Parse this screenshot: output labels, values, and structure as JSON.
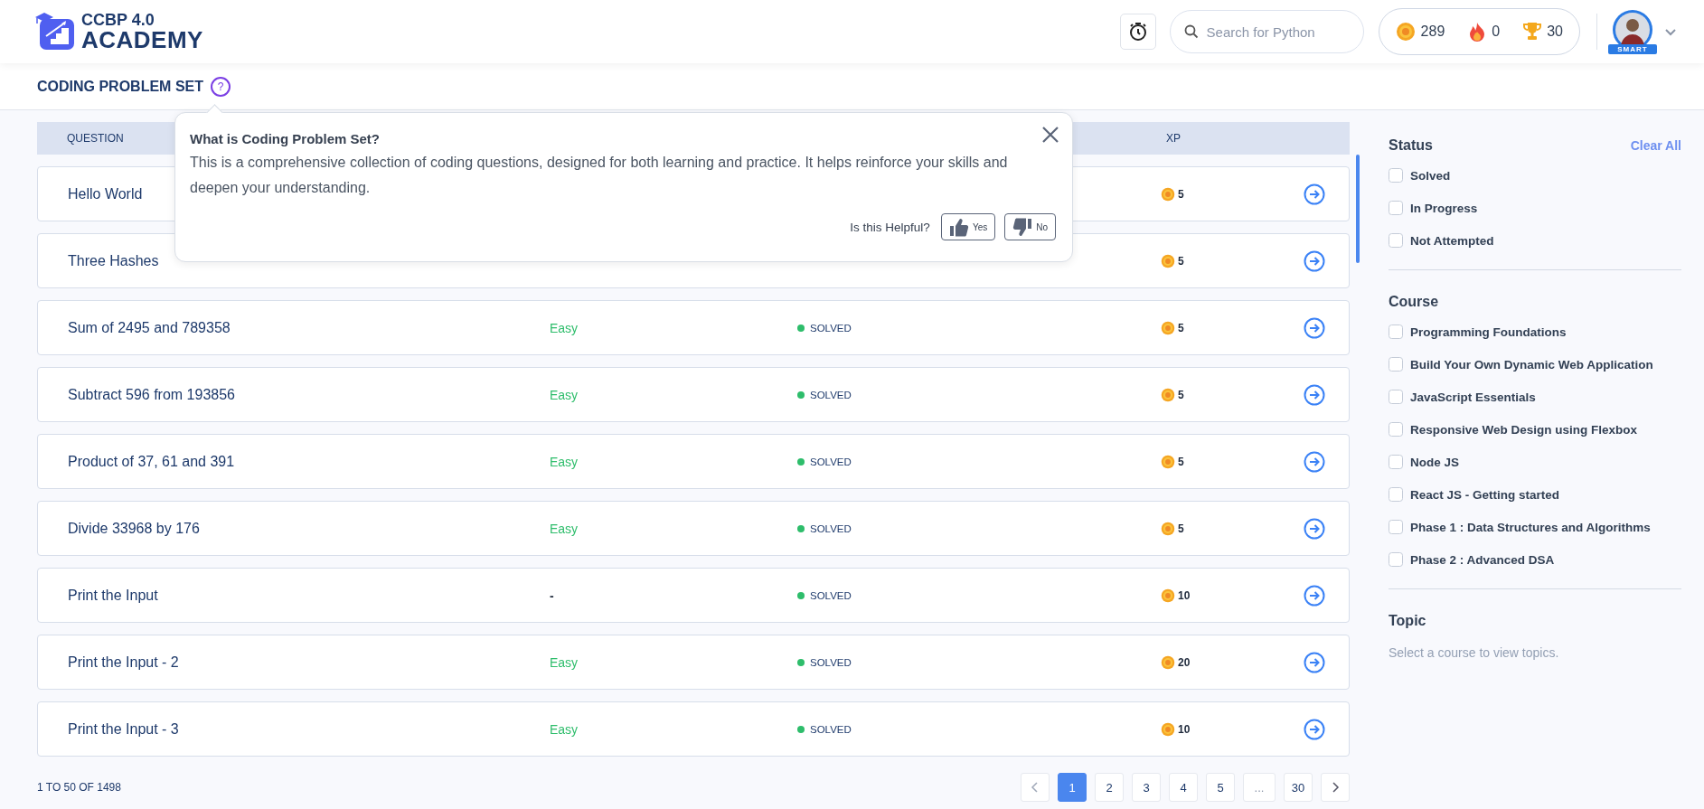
{
  "header": {
    "logo_line1": "CCBP 4.0",
    "logo_line2": "ACADEMY",
    "search": {
      "placeholder": "Search for Python"
    },
    "stats": [
      {
        "kind": "xp",
        "value": "289"
      },
      {
        "kind": "streak",
        "value": "0"
      },
      {
        "kind": "trophy",
        "value": "30"
      }
    ],
    "avatar_badge": "SMART"
  },
  "page_title": {
    "text": "CODING PROBLEM SET",
    "help_glyph": "?"
  },
  "table": {
    "columns": [
      "QUESTION",
      "XP"
    ],
    "rows": [
      {
        "question": "Hello World",
        "xp": "5"
      },
      {
        "question": "Three Hashes",
        "xp": "5"
      },
      {
        "question": "Sum of 2495 and 789358",
        "difficulty": "Easy",
        "kind": "rated",
        "status": "SOLVED",
        "xp": "5"
      },
      {
        "question": "Subtract 596 from 193856",
        "difficulty": "Easy",
        "kind": "rated",
        "status": "SOLVED",
        "xp": "5"
      },
      {
        "question": "Product of 37, 61 and 391",
        "difficulty": "Easy",
        "kind": "rated",
        "status": "SOLVED",
        "xp": "5"
      },
      {
        "question": "Divide 33968 by 176",
        "difficulty": "Easy",
        "kind": "rated",
        "status": "SOLVED",
        "xp": "5"
      },
      {
        "question": "Print the Input",
        "difficulty": "-",
        "kind": "unrated",
        "status": "SOLVED",
        "xp": "10"
      },
      {
        "question": "Print the Input - 2",
        "difficulty": "Easy",
        "kind": "rated",
        "status": "SOLVED",
        "xp": "20"
      },
      {
        "question": "Print the Input - 3",
        "difficulty": "Easy",
        "kind": "rated",
        "status": "SOLVED",
        "xp": "10"
      }
    ]
  },
  "popup": {
    "title": "What is Coding Problem Set?",
    "body": "This is a comprehensive collection of coding questions, designed for both learning and practice. It helps reinforce your skills and deepen your understanding.",
    "question": "Is this Helpful?",
    "buttons": [
      {
        "kind": "up",
        "label": "Yes"
      },
      {
        "kind": "down",
        "label": "No"
      }
    ]
  },
  "sidebar": {
    "clear_all": "Clear All",
    "sections": [
      {
        "title": "Status",
        "options": [
          {
            "label": "Solved",
            "checked": false
          },
          {
            "label": "In Progress",
            "checked": false
          },
          {
            "label": "Not Attempted",
            "checked": false
          }
        ]
      },
      {
        "title": "Course",
        "options": [
          {
            "label": "Programming Foundations",
            "checked": false
          },
          {
            "label": "Build Your Own Dynamic Web Application",
            "checked": false
          },
          {
            "label": "JavaScript Essentials",
            "checked": false
          },
          {
            "label": "Responsive Web Design using Flexbox",
            "checked": false
          },
          {
            "label": "Node JS",
            "checked": false
          },
          {
            "label": "React JS - Getting started",
            "checked": false
          },
          {
            "label": "Phase 1 : Data Structures and Algorithms",
            "checked": false
          },
          {
            "label": "Phase 2 : Advanced DSA",
            "checked": false
          }
        ]
      },
      {
        "title": "Topic",
        "hint": "Select a course to view topics."
      }
    ]
  },
  "pagination": {
    "summary": "1 TO 50 OF 1498",
    "pages": [
      {
        "kind": "page",
        "label": "1",
        "selected": true
      },
      {
        "kind": "page",
        "label": "2",
        "selected": false
      },
      {
        "kind": "page",
        "label": "3",
        "selected": false
      },
      {
        "kind": "page",
        "label": "4",
        "selected": false
      },
      {
        "kind": "page",
        "label": "5",
        "selected": false
      },
      {
        "kind": "ellipsis",
        "label": "..."
      },
      {
        "kind": "page",
        "label": "30",
        "selected": false
      }
    ]
  }
}
